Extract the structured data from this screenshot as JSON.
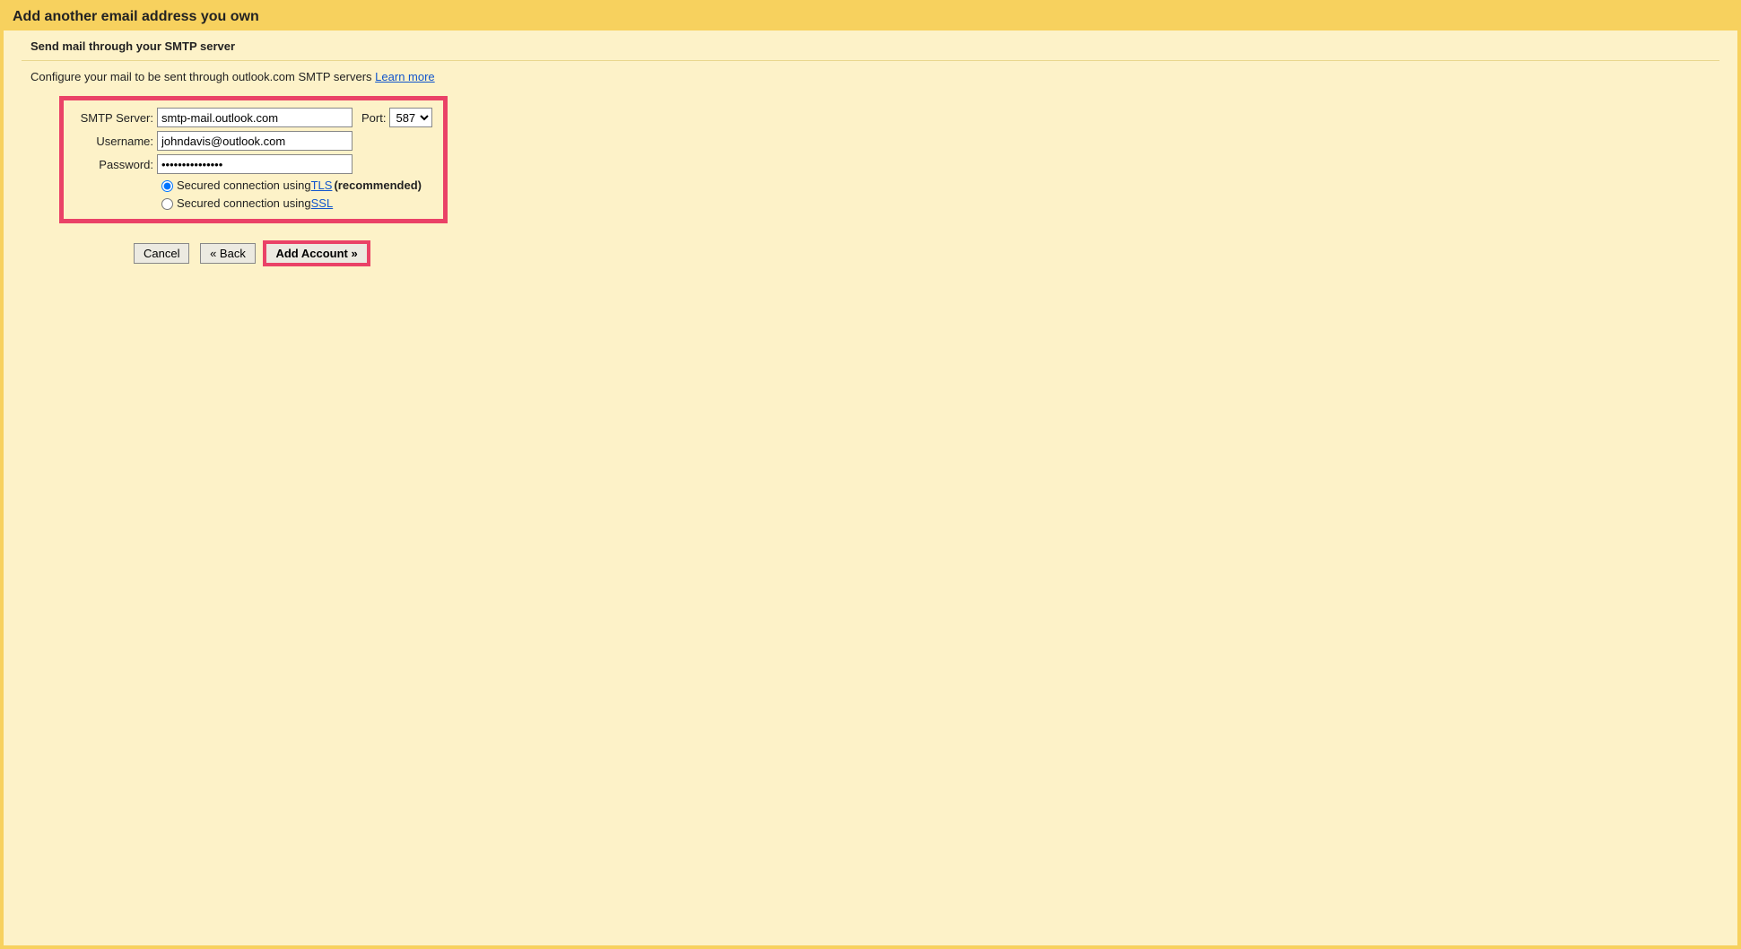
{
  "header": {
    "title": "Add another email address you own"
  },
  "subtitle": "Send mail through your SMTP server",
  "instruction": {
    "text": "Configure your mail to be sent through outlook.com SMTP servers ",
    "link": "Learn more"
  },
  "form": {
    "smtp_label": "SMTP Server:",
    "smtp_value": "smtp-mail.outlook.com",
    "port_label": "Port:",
    "port_value": "587",
    "username_label": "Username:",
    "username_value": "johndavis@outlook.com",
    "password_label": "Password:",
    "password_value": "•••••••••••••••",
    "radio_tls_prefix": "Secured connection using ",
    "radio_tls_link": "TLS",
    "radio_tls_suffix": "(recommended)",
    "radio_ssl_prefix": "Secured connection using ",
    "radio_ssl_link": "SSL"
  },
  "buttons": {
    "cancel": "Cancel",
    "back": "« Back",
    "add": "Add Account »"
  }
}
